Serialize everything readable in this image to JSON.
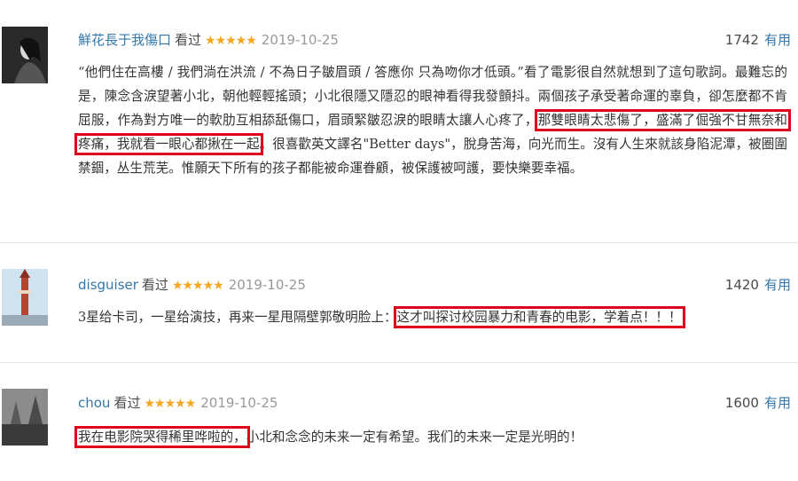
{
  "reviews": [
    {
      "author": "鮮花長于我傷口",
      "watched": "看过",
      "stars": "★★★★★",
      "date": "2019-10-25",
      "votes": "1742",
      "vote_label": "有用",
      "text_pre": "“他們住在高樓 / 我們淌在洪流 / 不為日子皺眉頭 / 答應你 只為吻你才低頭。”看了電影很自然就想到了這句歌詞。最難忘的是，陳念含淚望著小北，朝他輕輕搖頭；小北很隱又隱忍的眼神看得我發顫抖。兩個孩子承受著命運的辜負，卻怎麼都不肯屈服，作為對方唯一的軟肋互相舔舐傷口，眉頭緊皺忍淚的眼睛太讓人心疼了，",
      "text_hl": "那雙眼睛太悲傷了，盛滿了倔強不甘無奈和疼痛，我就看一眼心都揪在一起",
      "text_post": "。很喜歡英文譯名\"Better days\"，脫身苦海，向光而生。沒有人生來就該身陷泥潭，被圈圍禁錮，丛生荒芜。惟願天下所有的孩子都能被命運眷顧，被保護被呵護，要快樂要幸福。"
    },
    {
      "author": "disguiser",
      "watched": "看过",
      "stars": "★★★★★",
      "date": "2019-10-25",
      "votes": "1420",
      "vote_label": "有用",
      "text_pre": "3星给卡司，一星给演技，再来一星甩隔壁郭敬明脸上：",
      "text_hl": "这才叫探讨校园暴力和青春的电影，学着点！！！",
      "text_post": ""
    },
    {
      "author": "chou",
      "watched": "看过",
      "stars": "★★★★★",
      "date": "2019-10-25",
      "votes": "1600",
      "vote_label": "有用",
      "text_pre": "",
      "text_hl": "我在电影院哭得稀里哗啦的，",
      "text_post": "小北和念念的未来一定有希望。我们的未来一定是光明的！"
    }
  ]
}
